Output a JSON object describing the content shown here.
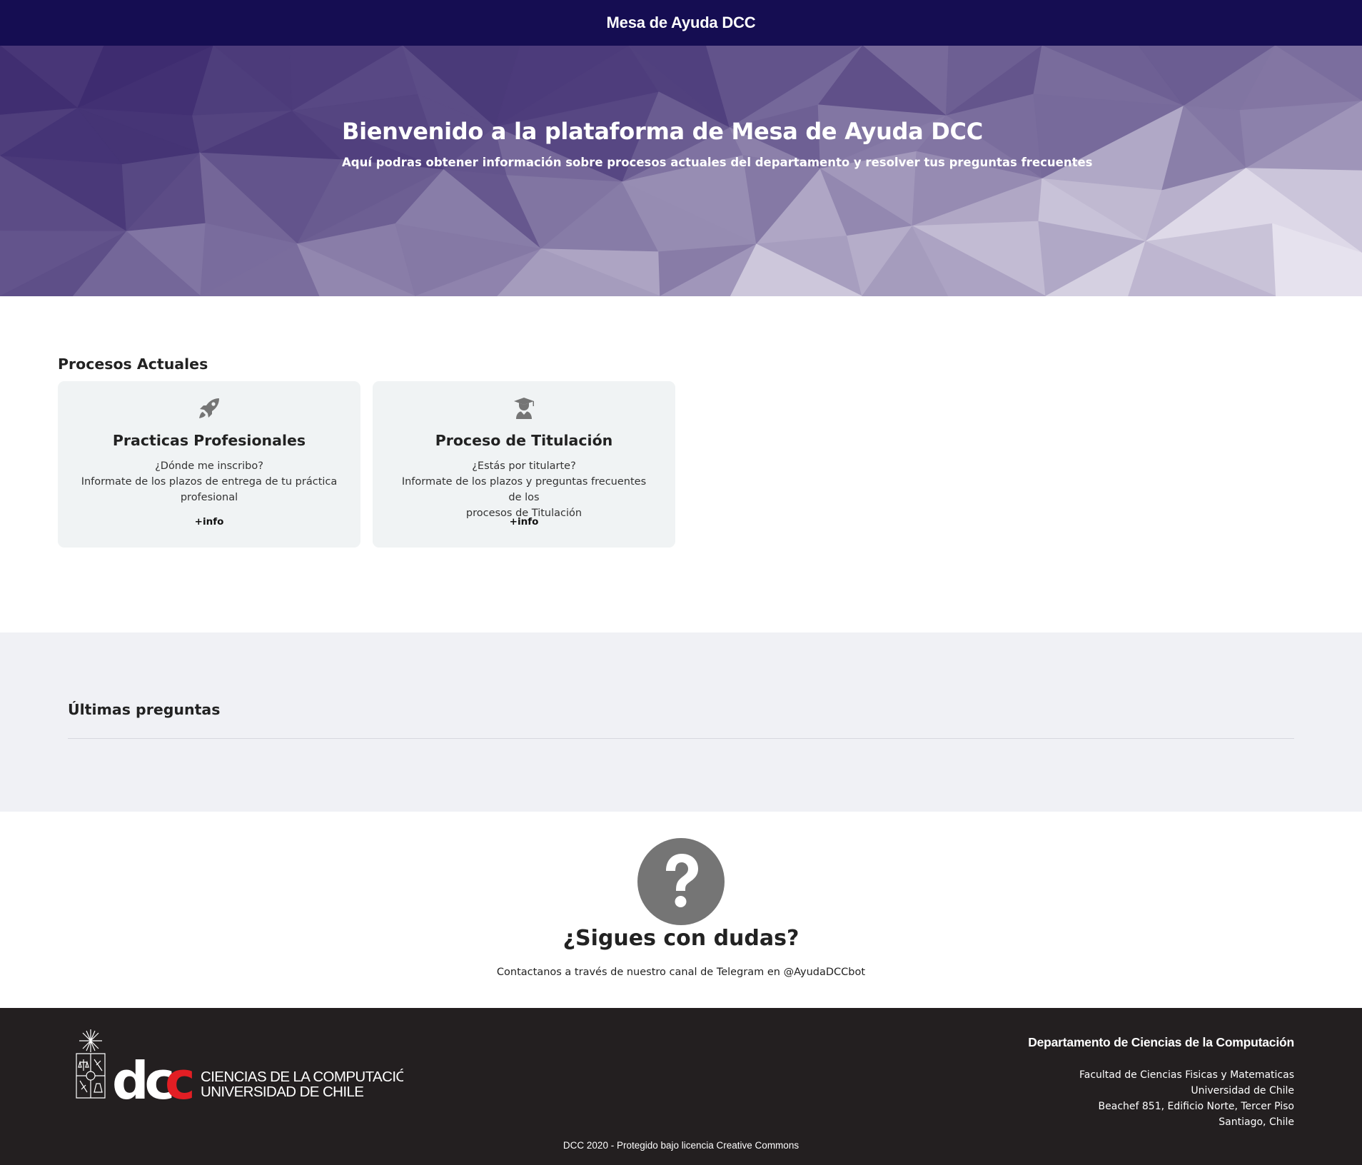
{
  "header": {
    "title": "Mesa de Ayuda DCC"
  },
  "hero": {
    "title": "Bienvenido a la plataforma de Mesa de Ayuda DCC",
    "subtitle": "Aquí podras obtener información sobre procesos actuales del departamento y resolver tus preguntas frecuentes"
  },
  "procesos": {
    "title": "Procesos Actuales",
    "cards": [
      {
        "icon": "rocket-icon",
        "title": "Practicas Profesionales",
        "question": "¿Dónde me inscribo?",
        "line2": "Informate de los plazos de entrega de tu práctica",
        "line3": "profesional",
        "more": "+info"
      },
      {
        "icon": "graduate-icon",
        "title": "Proceso de Titulación",
        "question": "¿Estás por titularte?",
        "line2": "Informate de los plazos y preguntas frecuentes de los",
        "line3": "procesos de Titulación",
        "more": "+info"
      }
    ]
  },
  "ultimas": {
    "title": "Últimas preguntas"
  },
  "dudas": {
    "icon": "question-circle-icon",
    "title": "¿Sigues con dudas?",
    "text": "Contactanos a través de nuestro canal de Telegram en @AyudaDCCbot"
  },
  "footer": {
    "logo": {
      "mark": "dcc",
      "line1": "CIENCIAS DE LA COMPUTACIÓN",
      "line2": "UNIVERSIDAD DE CHILE"
    },
    "department": "Departamento de Ciencias de la Computación",
    "address": [
      "Facultad de Ciencias Fisicas y Matematicas",
      "Universidad de Chile",
      "Beachef 851, Edificio Norte, Tercer Piso",
      "Santiago, Chile"
    ],
    "copyright": "DCC 2020 - Protegido bajo licencia Creative Commons"
  },
  "colors": {
    "header_bg": "#150d52",
    "hero_dark": "#3d2d6e",
    "hero_light": "#e4e1ec",
    "card_bg": "#f0f3f4",
    "section_bg": "#f0f1f5",
    "footer_bg": "#231f20",
    "icon_gray": "#757575",
    "logo_red": "#e31e24"
  }
}
